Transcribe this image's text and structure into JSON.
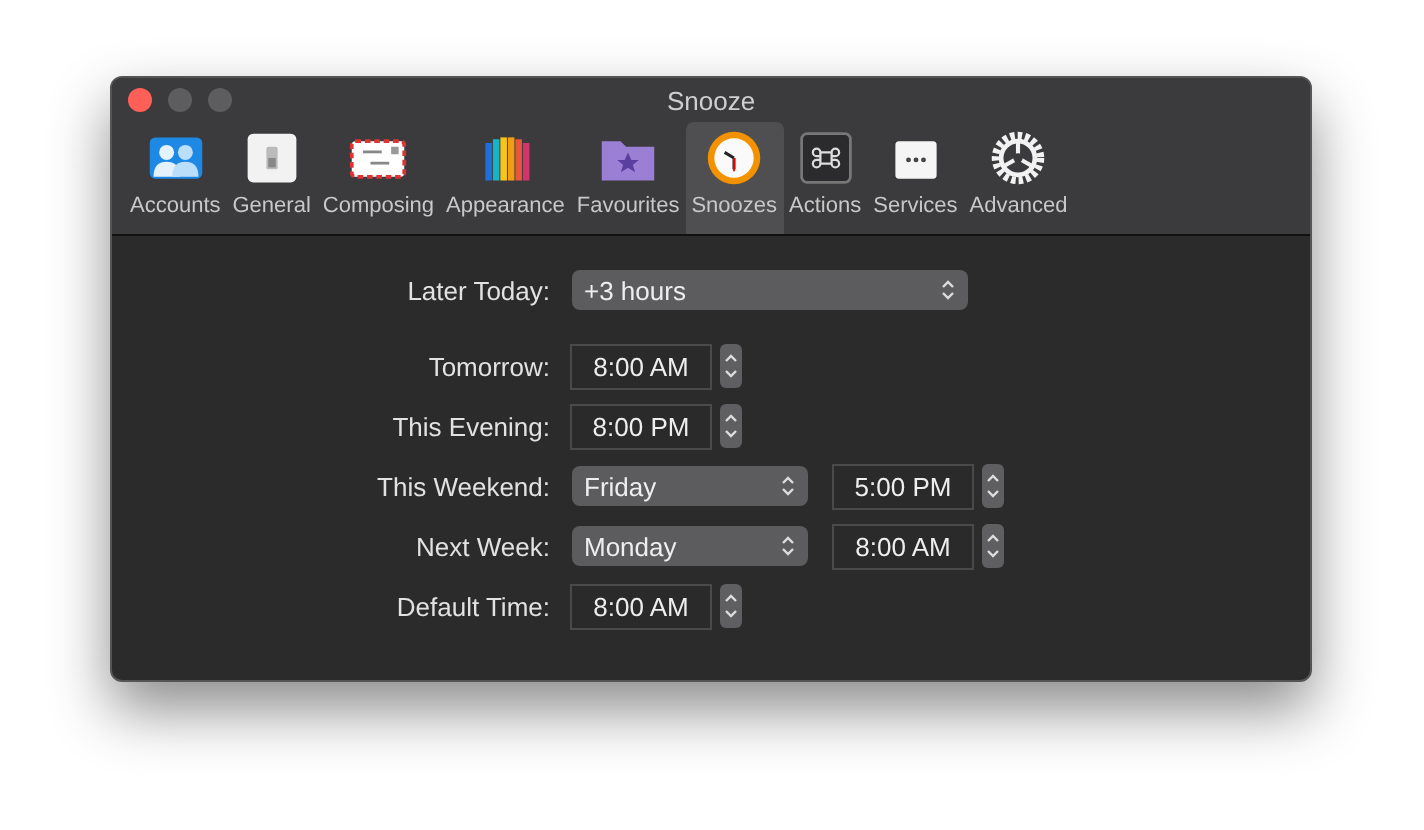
{
  "window": {
    "title": "Snooze"
  },
  "tabs": [
    {
      "label": "Accounts",
      "selected": false
    },
    {
      "label": "General",
      "selected": false
    },
    {
      "label": "Composing",
      "selected": false
    },
    {
      "label": "Appearance",
      "selected": false
    },
    {
      "label": "Favourites",
      "selected": false
    },
    {
      "label": "Snoozes",
      "selected": true
    },
    {
      "label": "Actions",
      "selected": false
    },
    {
      "label": "Services",
      "selected": false
    },
    {
      "label": "Advanced",
      "selected": false
    }
  ],
  "rows": [
    {
      "kind": "select-wide",
      "label": "Later Today:",
      "select": "+3 hours"
    },
    {
      "kind": "time",
      "label": "Tomorrow:",
      "time": "8:00 AM"
    },
    {
      "kind": "time",
      "label": "This Evening:",
      "time": "8:00 PM"
    },
    {
      "kind": "select-time",
      "label": "This Weekend:",
      "select": "Friday",
      "time": "5:00 PM"
    },
    {
      "kind": "select-time",
      "label": "Next Week:",
      "select": "Monday",
      "time": "8:00 AM"
    },
    {
      "kind": "time",
      "label": "Default Time:",
      "time": "8:00 AM"
    }
  ]
}
